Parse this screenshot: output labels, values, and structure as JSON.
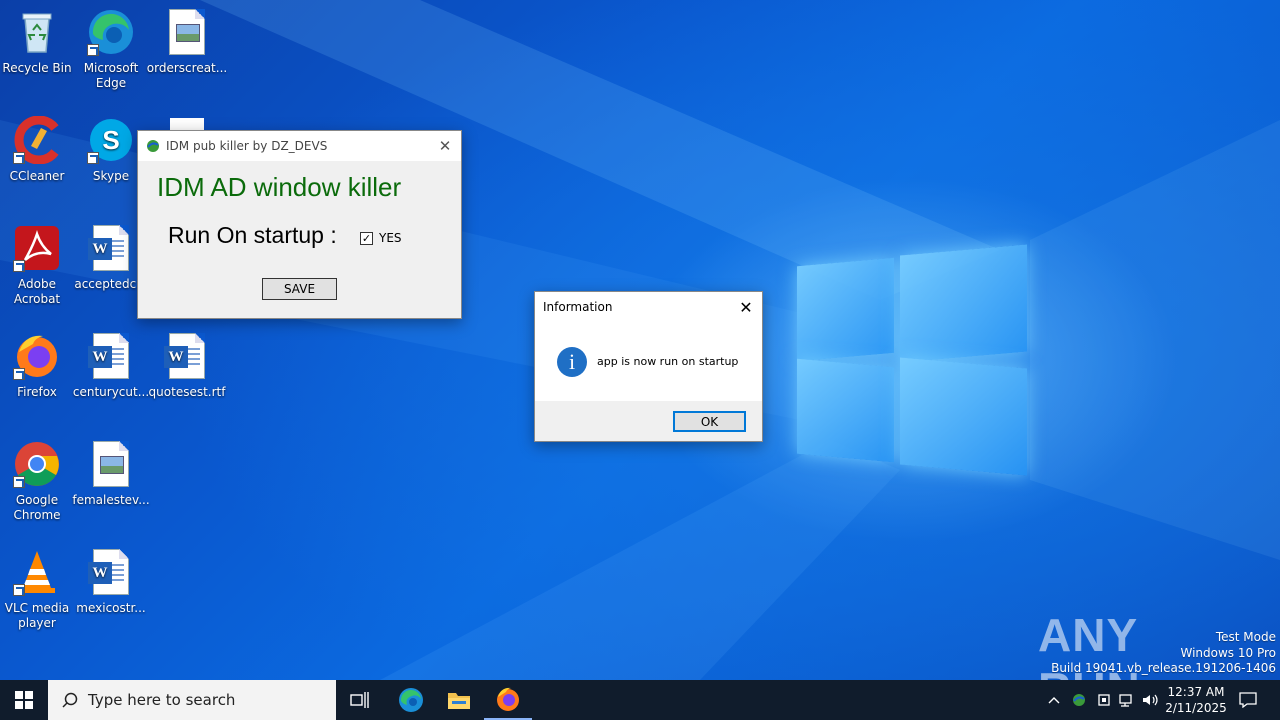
{
  "desktop_icons": [
    {
      "label": "Recycle Bin"
    },
    {
      "label": "Microsoft Edge"
    },
    {
      "label": "orderscreat..."
    },
    {
      "label": "CCleaner"
    },
    {
      "label": "Skype"
    },
    {
      "label": "Adobe Acrobat"
    },
    {
      "label": "acceptedc..."
    },
    {
      "label": "Firefox"
    },
    {
      "label": "centurycut..."
    },
    {
      "label": "quotesest.rtf"
    },
    {
      "label": "Google Chrome"
    },
    {
      "label": "femalestev..."
    },
    {
      "label": "VLC media player"
    },
    {
      "label": "mexicostr..."
    }
  ],
  "idm_window": {
    "title": "IDM pub killer by DZ_DEVS",
    "heading": "IDM AD window killer",
    "startup_label": "Run On startup :",
    "checkbox_label": "YES",
    "checkbox_checked": true,
    "save_label": "SAVE",
    "heading_color": "#0b6b0b"
  },
  "info_dialog": {
    "title": "Information",
    "message": "app is now run on startup",
    "ok_label": "OK",
    "icon": "info-icon"
  },
  "watermark": {
    "brand": "ANY RUN",
    "line1": "Test Mode",
    "line2": "Windows 10 Pro",
    "line3": "Build 19041.vb_release.191206-1406"
  },
  "taskbar": {
    "search_placeholder": "Type here to search",
    "time": "12:37 AM",
    "date": "2/11/2025",
    "apps": [
      "task-view-icon",
      "edge-icon",
      "file-explorer-icon",
      "firefox-icon"
    ]
  },
  "colors": {
    "accent": "#0078d7",
    "taskbar": "#101c2c"
  }
}
